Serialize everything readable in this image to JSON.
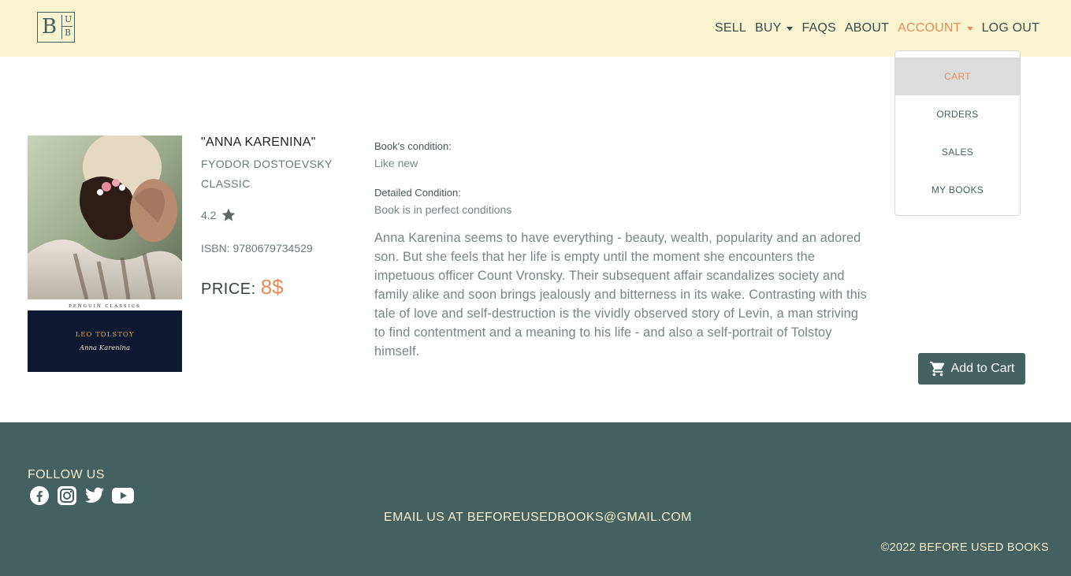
{
  "brand": {
    "logo_letters": "B",
    "logo_u": "U",
    "logo_b": "B"
  },
  "nav": {
    "sell": "SELL",
    "buy": "BUY",
    "faqs": "FAQS",
    "about": "ABOUT",
    "account": "ACCOUNT",
    "logout": "LOG OUT"
  },
  "account_menu": {
    "items": [
      "CART",
      "ORDERS",
      "SALES",
      "MY BOOKS"
    ],
    "active": "CART"
  },
  "book": {
    "cover_publisher": "PENGUIN CLASSICS",
    "cover_author": "LEO TOLSTOY",
    "cover_title": "Anna Karenina",
    "title": "\"ANNA KARENINA\"",
    "author": "FYODOR DOSTOEVSKY",
    "genre": "CLASSIC",
    "rating": "4.2",
    "isbn": "ISBN: 9780679734529",
    "price_label": "PRICE:",
    "price_value": "8$",
    "condition_label": "Book's condition:",
    "condition_value": "Like new",
    "detailed_label": "Detailed Condition:",
    "detailed_value": "Book is in perfect conditions",
    "description": "Anna Karenina seems to have everything - beauty, wealth, popularity and an adored son. But she feels that her life is empty until the moment she encounters the impetuous officer Count Vronsky. Their subsequent affair scandalizes society and family alike and soon brings jealously and bitterness in its wake. Contrasting with this tale of love and self-destruction is the vividly observed story of Levin, a man striving to find contentment and a meaning to his life - and also a self-portrait of Tolstoy himself."
  },
  "add_to_cart": "Add to Cart",
  "footer": {
    "follow": "FOLLOW US",
    "socials": [
      "facebook-icon",
      "instagram-icon",
      "twitter-icon",
      "youtube-icon"
    ],
    "email": "EMAIL US AT BEFOREUSEDBOOKS@GMAIL.COM",
    "copyright": "©2022 BEFORE USED BOOKS"
  },
  "colors": {
    "header_bg": "#f8f4d0",
    "accent": "#e58c5e",
    "primary": "#44615f"
  }
}
